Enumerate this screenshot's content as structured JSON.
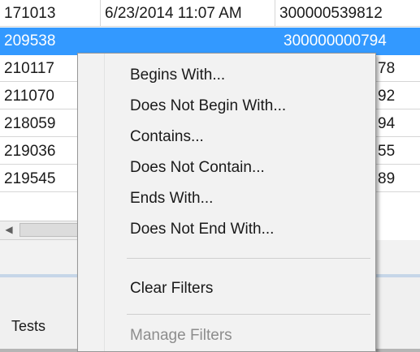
{
  "grid": {
    "rows": [
      {
        "id": "171013",
        "date": "6/23/2014 11:07 AM",
        "number": "300000539812",
        "selected": false
      },
      {
        "id": "209538",
        "date": "",
        "number": "300000000794",
        "selected": true
      },
      {
        "id": "210117",
        "date": "",
        "number": "78",
        "selected": false
      },
      {
        "id": "211070",
        "date": "",
        "number": "92",
        "selected": false
      },
      {
        "id": "218059",
        "date": "",
        "number": "94",
        "selected": false
      },
      {
        "id": "219036",
        "date": "",
        "number": "55",
        "selected": false
      },
      {
        "id": "219545",
        "date": "",
        "number": "89",
        "selected": false
      }
    ]
  },
  "scrollbar": {
    "left_arrow_icon": "◀"
  },
  "bottom_panel": {
    "tab_label": "Tests"
  },
  "context_menu": {
    "items": [
      {
        "label": "Begins With...",
        "enabled": true
      },
      {
        "label": "Does Not Begin With...",
        "enabled": true
      },
      {
        "label": "Contains...",
        "enabled": true
      },
      {
        "label": "Does Not Contain...",
        "enabled": true
      },
      {
        "label": "Ends With...",
        "enabled": true
      },
      {
        "label": "Does Not End With...",
        "enabled": true
      },
      {
        "label": "Clear Filters",
        "enabled": true
      },
      {
        "label": "Manage Filters",
        "enabled": false
      }
    ]
  },
  "colors": {
    "selection": "#3399ff",
    "menu_background": "#f2f2f2",
    "disabled_text": "#8d8d8d"
  }
}
